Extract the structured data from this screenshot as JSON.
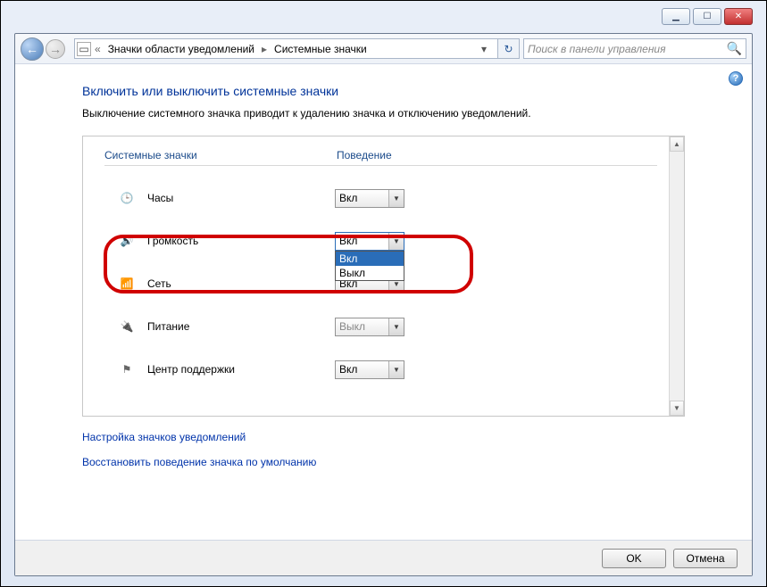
{
  "window": {
    "min_tip": "Minimize",
    "max_tip": "Maximize",
    "close_tip": "Close"
  },
  "nav": {
    "crumb1": "Значки области уведомлений",
    "crumb2": "Системные значки"
  },
  "search": {
    "placeholder": "Поиск в панели управления"
  },
  "page": {
    "title": "Включить или выключить системные значки",
    "subtitle": "Выключение системного значка приводит к удалению значка и отключению уведомлений."
  },
  "headers": {
    "col1": "Системные значки",
    "col2": "Поведение"
  },
  "options": {
    "on": "Вкл",
    "off": "Выкл"
  },
  "rows": [
    {
      "label": "Часы",
      "value": "Вкл",
      "disabled": false,
      "open": false
    },
    {
      "label": "Громкость",
      "value": "Вкл",
      "disabled": false,
      "open": true
    },
    {
      "label": "Сеть",
      "value": "Вкл",
      "disabled": false,
      "open": false
    },
    {
      "label": "Питание",
      "value": "Выкл",
      "disabled": true,
      "open": false
    },
    {
      "label": "Центр поддержки",
      "value": "Вкл",
      "disabled": false,
      "open": false
    }
  ],
  "links": {
    "customize": "Настройка значков уведомлений",
    "restore": "Восстановить поведение значка по умолчанию"
  },
  "buttons": {
    "ok": "OK",
    "cancel": "Отмена"
  }
}
